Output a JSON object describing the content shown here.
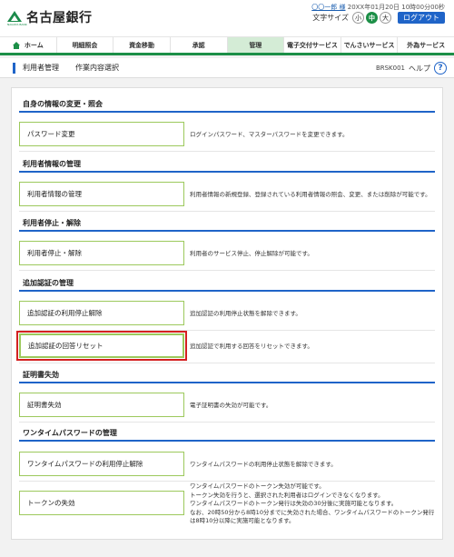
{
  "header": {
    "bank_name": "名古屋銀行",
    "logo_sub": "NAGOYA BANK",
    "user_name": "〇〇一郎 様",
    "last_login": "20XX年01月20日 10時00分00秒",
    "font_size_label": "文字サイズ",
    "font_sizes": [
      "小",
      "中",
      "大"
    ],
    "font_size_selected": "中",
    "logout_label": "ログアウト"
  },
  "nav": {
    "items": [
      "ホーム",
      "明細照会",
      "資金移動",
      "承認",
      "管理",
      "電子交付サービス",
      "でんさいサービス",
      "外為サービス"
    ],
    "active": "管理"
  },
  "titlebar": {
    "title": "利用者管理",
    "subtitle": "作業内容選択",
    "screen_id": "BRSK001",
    "help_label": "ヘルプ",
    "help_icon": "?"
  },
  "sections": [
    {
      "heading": "自身の情報の変更・照会",
      "rows": [
        {
          "button": "パスワード変更",
          "desc": [
            "ログインパスワード、マスターパスワードを変更できます。"
          ]
        }
      ]
    },
    {
      "heading": "利用者情報の管理",
      "rows": [
        {
          "button": "利用者情報の管理",
          "desc": [
            "利用者情報の新規登録、登録されている利用者情報の照会、変更、または削除が可能です。"
          ]
        }
      ]
    },
    {
      "heading": "利用者停止・解除",
      "rows": [
        {
          "button": "利用者停止・解除",
          "desc": [
            "利用者のサービス停止、停止解除が可能です。"
          ]
        }
      ]
    },
    {
      "heading": "追加認証の管理",
      "rows": [
        {
          "button": "追加認証の利用停止解除",
          "desc": [
            "追加認証の利用停止状態を解除できます。"
          ]
        },
        {
          "button": "追加認証の回答リセット",
          "desc": [
            "追加認証で利用する回答をリセットできます。"
          ]
        }
      ]
    },
    {
      "heading": "証明書失効",
      "rows": [
        {
          "button": "証明書失効",
          "desc": [
            "電子証明書の失効が可能です。"
          ]
        }
      ]
    },
    {
      "heading": "ワンタイムパスワードの管理",
      "rows": [
        {
          "button": "ワンタイムパスワードの利用停止解除",
          "desc": [
            "ワンタイムパスワードの利用停止状態を解除できます。"
          ]
        },
        {
          "button": "トークンの失効",
          "desc": [
            "ワンタイムパスワードのトークン失効が可能です。",
            "トークン失効を行うと、選択された利用者はログインできなくなります。",
            "ワンタイムパスワードのトークン発行は失効の30分後に実施可能となります。",
            "なお、20時50分から8時10分までに失効された場合、ワンタイムパスワードのトークン発行",
            "は8時10分以降に実施可能となります。"
          ]
        }
      ]
    }
  ],
  "selected_button": "追加認証の回答リセット",
  "colors": {
    "brand_green": "#1c8f47",
    "nav_active_bg": "#d4ecd6",
    "section_rule": "#1f64c8",
    "button_border": "#9cc95c",
    "highlight_red": "#d42020",
    "logout_bg": "#1f64c8"
  }
}
